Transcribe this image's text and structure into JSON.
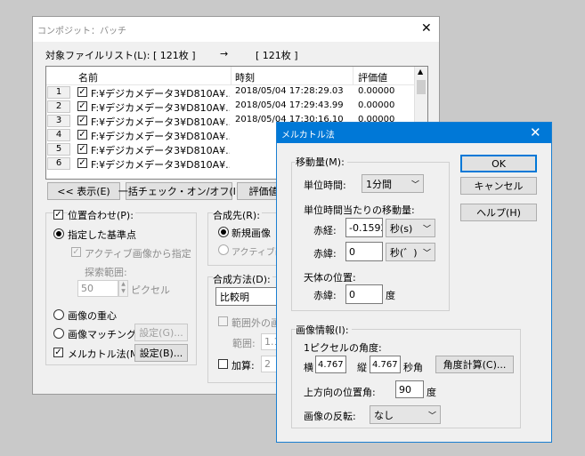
{
  "batch": {
    "title": "コンポジット：バッチ",
    "list_label": "対象ファイルリスト(L):",
    "count_src": "[ 121枚 ]",
    "arrow": "→",
    "count_dst": "[ 121枚 ]",
    "columns": [
      "名前",
      "時刻",
      "評価値"
    ],
    "rows": [
      {
        "num": "1",
        "name": "F:¥デジカメデータ3¥D810A¥...",
        "time": "2018/05/04  17:28:29.03",
        "score": "0.00000"
      },
      {
        "num": "2",
        "name": "F:¥デジカメデータ3¥D810A¥...",
        "time": "2018/05/04  17:29:43.99",
        "score": "0.00000"
      },
      {
        "num": "3",
        "name": "F:¥デジカメデータ3¥D810A¥...",
        "time": "2018/05/04  17:30:16.10",
        "score": "0.00000"
      },
      {
        "num": "4",
        "name": "F:¥デジカメデータ3¥D810A¥...",
        "time": "",
        "score": ""
      },
      {
        "num": "5",
        "name": "F:¥デジカメデータ3¥D810A¥...",
        "time": "",
        "score": ""
      },
      {
        "num": "6",
        "name": "F:¥デジカメデータ3¥D810A¥...",
        "time": "",
        "score": ""
      }
    ],
    "btn_display": "<< 表示(E)",
    "btn_check_all": "一括チェック・オン/オフ(I)",
    "btn_score": "評価値",
    "align_check": "位置合わせ(P):",
    "radio_specified": "指定した基準点",
    "active_from": "アクティブ画像から指定",
    "search_range": "探索範囲:",
    "search_value": "50",
    "pixel": "ピクセル",
    "radio_centroid": "画像の重心",
    "radio_matching": "画像マッチング",
    "btn_settings_g": "設定(G)...",
    "mercator_check": "メルカトル法(M)",
    "btn_settings_b": "設定(B)...",
    "dest_label": "合成先(R):",
    "radio_new": "新規画像",
    "radio_active": "アクティブ画像",
    "method_label": "合成方法(D):",
    "method_value": "比較明",
    "outside_range": "範囲外の画",
    "range_label": "範囲:",
    "range_value": "1.1",
    "add_label": "加算:",
    "add_value": "2"
  },
  "mercator": {
    "title": "メルカトル法",
    "movement_label": "移動量(M):",
    "unit_time_label": "単位時間:",
    "unit_time_value": "1分間",
    "per_unit_label": "単位時間当たりの移動量:",
    "ra_label": "赤経:",
    "ra_value": "-0.1592",
    "ra_unit": "秒(s)",
    "dec_label": "赤緯:",
    "dec_value": "0",
    "dec_unit": "秒(゛)",
    "pole_label": "天体の位置:",
    "pole_dec_label": "赤緯:",
    "pole_dec_value": "0",
    "degree": "度",
    "image_info_label": "画像情報(I):",
    "pixel_angle_label": "1ピクセルの角度:",
    "h_label": "横",
    "h_value": "4.767",
    "v_label": "縦",
    "v_value": "4.767",
    "sec_angle": "秒角",
    "btn_calc": "角度計算(C)...",
    "up_angle_label": "上方向の位置角:",
    "up_angle_value": "90",
    "flip_label": "画像の反転:",
    "flip_value": "なし",
    "ok": "OK",
    "cancel": "キャンセル",
    "help": "ヘルプ(H)"
  }
}
